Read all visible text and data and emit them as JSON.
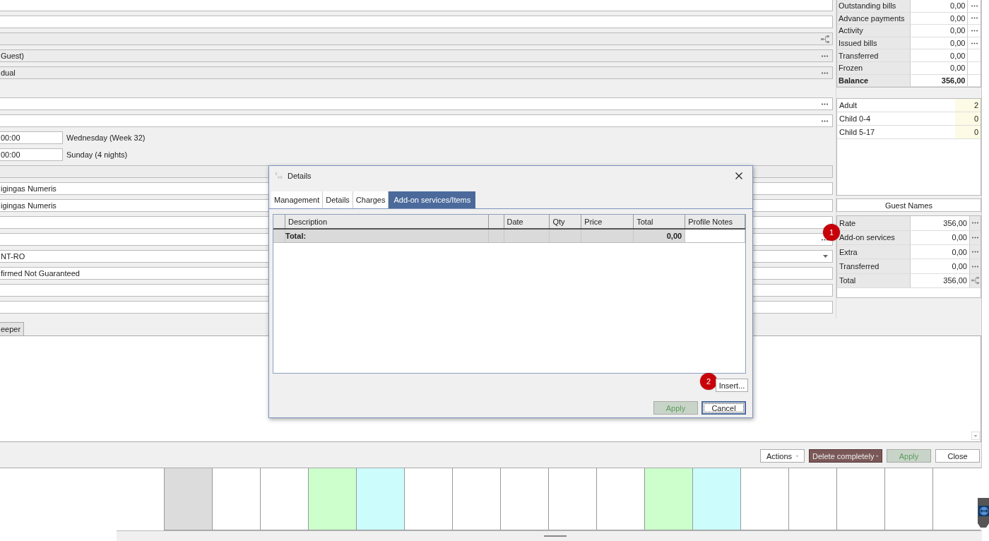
{
  "form_sections": [
    [
      {
        "kind": "input"
      },
      {
        "kind": "input"
      },
      {
        "kind": "readonly",
        "share": true
      },
      {
        "kind": "readonly",
        "value": "Guest)",
        "more": true
      },
      {
        "kind": "readonly",
        "value": "dual",
        "more": true
      }
    ],
    [
      {
        "kind": "input",
        "more": true
      },
      {
        "kind": "input",
        "more": true
      },
      {
        "kind": "time",
        "value": "00:00",
        "note": "Wednesday (Week 32)"
      },
      {
        "kind": "time",
        "value": "00:00",
        "note": "Sunday (4 nights)"
      },
      {
        "kind": "readonly"
      },
      {
        "kind": "input",
        "value": "igingas Numeris"
      },
      {
        "kind": "input",
        "value": "igingas Numeris"
      },
      {
        "kind": "input"
      },
      {
        "kind": "input",
        "more": true
      },
      {
        "kind": "input",
        "value": "NT-RO",
        "dropdown": true
      },
      {
        "kind": "input",
        "value": "firmed Not Guaranteed"
      },
      {
        "kind": "input"
      },
      {
        "kind": "input"
      }
    ]
  ],
  "bottom_tab": {
    "label": "eeper"
  },
  "account": [
    {
      "label": "Outstanding bills",
      "value": "0,00",
      "more": true,
      "total": false
    },
    {
      "label": "Advance payments",
      "value": "0,00",
      "more": true,
      "total": false
    },
    {
      "label": "Activity",
      "value": "0,00",
      "more": true,
      "total": false
    },
    {
      "label": "Issued bills",
      "value": "0,00",
      "more": true,
      "total": false
    },
    {
      "label": "Transferred",
      "value": "0,00",
      "more": false,
      "total": false
    },
    {
      "label": "Frozen",
      "value": "0,00",
      "more": false,
      "total": false
    },
    {
      "label": "Balance",
      "value": "356,00",
      "more": false,
      "total": true
    }
  ],
  "occupants": [
    {
      "label": "Adult",
      "value": "2"
    },
    {
      "label": "Child 0-4",
      "value": "0"
    },
    {
      "label": "Child 5-17",
      "value": "0"
    }
  ],
  "guest_names_button": "Guest Names",
  "charges": [
    {
      "label": "Rate",
      "value": "356,00",
      "kind": "more"
    },
    {
      "label": "Add-on services",
      "value": "0,00",
      "kind": "more",
      "badge": "1"
    },
    {
      "label": "Extra",
      "value": "0,00",
      "kind": "more"
    },
    {
      "label": "Transferred",
      "value": "0,00",
      "kind": "more"
    },
    {
      "label": "Total",
      "value": "356,00",
      "kind": "share"
    }
  ],
  "dialog": {
    "title": "Details",
    "tabs": [
      {
        "label": "Management",
        "selected": false
      },
      {
        "label": "Details",
        "selected": false
      },
      {
        "label": "Charges",
        "selected": false
      },
      {
        "label": "Add-on services/Items",
        "selected": true
      }
    ],
    "columns": [
      {
        "kind": "marker"
      },
      {
        "kind": "text",
        "label": "Description"
      },
      {
        "kind": "marker"
      },
      {
        "kind": "text",
        "label": "Date"
      },
      {
        "kind": "text",
        "label": "Qty"
      },
      {
        "kind": "text",
        "label": "Price"
      },
      {
        "kind": "text",
        "label": "Total"
      },
      {
        "kind": "text",
        "label": "Profile Notes"
      }
    ],
    "total_row": {
      "label": "Total:",
      "value": "0,00"
    },
    "insert": {
      "label": "Insert...",
      "badge": "2"
    },
    "buttons": [
      {
        "label": "Apply",
        "disabled": true,
        "focused": false
      },
      {
        "label": "Cancel",
        "disabled": false,
        "focused": true
      }
    ]
  },
  "actions": [
    {
      "label": "Actions",
      "kind": "dropdown"
    },
    {
      "label": "Delete completely",
      "kind": "danger"
    },
    {
      "label": "Apply",
      "kind": "disabled"
    },
    {
      "label": "Close",
      "kind": "plain"
    }
  ],
  "calendar": [
    {
      "color": "#dcdcdc"
    },
    {
      "color": "#ffffff"
    },
    {
      "color": "#ffffff"
    },
    {
      "color": "#ccffcc"
    },
    {
      "color": "#ccfcfc"
    },
    {
      "color": "#ffffff"
    },
    {
      "color": "#ffffff"
    },
    {
      "color": "#ffffff"
    },
    {
      "color": "#ffffff"
    },
    {
      "color": "#ffffff"
    },
    {
      "color": "#ccffcc"
    },
    {
      "color": "#ccfcfc"
    },
    {
      "color": "#ffffff"
    },
    {
      "color": "#ffffff"
    },
    {
      "color": "#ffffff"
    },
    {
      "color": "#ffffff"
    },
    {
      "color": "#ffffff"
    }
  ]
}
